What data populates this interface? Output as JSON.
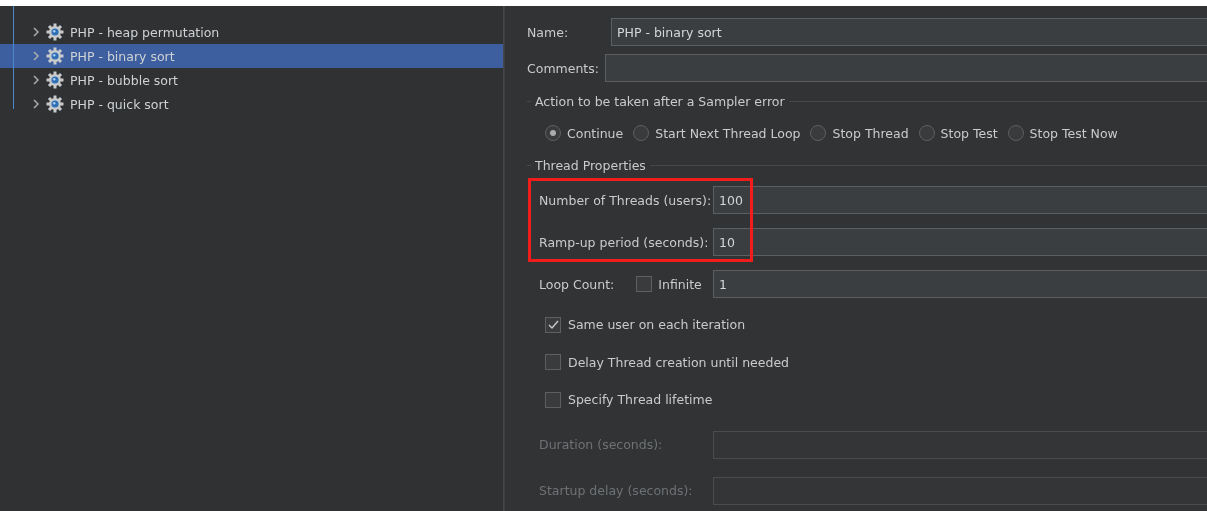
{
  "tree": {
    "items": [
      {
        "label": "PHP - heap permutation",
        "selected": false,
        "expanded": false
      },
      {
        "label": "PHP - binary sort",
        "selected": true,
        "expanded": false
      },
      {
        "label": "PHP - bubble sort",
        "selected": false,
        "expanded": false
      },
      {
        "label": "PHP - quick sort",
        "selected": false,
        "expanded": false
      }
    ]
  },
  "form": {
    "name": {
      "label": "Name:",
      "value": "PHP - binary sort"
    },
    "comments": {
      "label": "Comments:"
    },
    "sampler_error": {
      "title": "Action to be taken after a Sampler error",
      "options": [
        {
          "label": "Continue",
          "selected": true
        },
        {
          "label": "Start Next Thread Loop",
          "selected": false
        },
        {
          "label": "Stop Thread",
          "selected": false
        },
        {
          "label": "Stop Test",
          "selected": false
        },
        {
          "label": "Stop Test Now",
          "selected": false
        }
      ]
    },
    "thread_properties": {
      "title": "Thread Properties",
      "highlighted": [
        {
          "label": "Number of Threads (users):",
          "value": "100"
        },
        {
          "label": "Ramp-up period (seconds):",
          "value": "10"
        }
      ],
      "loop_count": {
        "label": "Loop Count:",
        "infinite_label": "Infinite",
        "infinite_checked": false,
        "value": "1"
      },
      "checkboxes": [
        {
          "label": "Same user on each iteration",
          "checked": true
        },
        {
          "label": "Delay Thread creation until needed",
          "checked": false
        },
        {
          "label": "Specify Thread lifetime",
          "checked": false
        }
      ],
      "lifetime_fields": [
        {
          "label": "Duration (seconds):",
          "disabled": true
        },
        {
          "label": "Startup delay (seconds):",
          "disabled": true
        }
      ]
    }
  }
}
